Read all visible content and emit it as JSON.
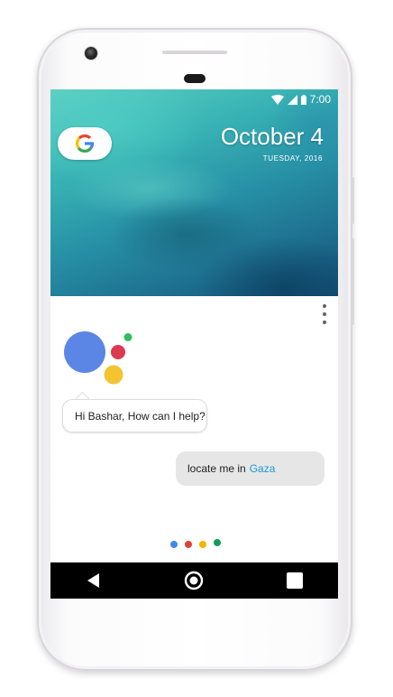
{
  "status_bar": {
    "time": "7:00"
  },
  "lockscreen": {
    "date": "October 4",
    "day": "TUESDAY, 2016",
    "search_widget_icon": "google-g-icon"
  },
  "assistant": {
    "menu_icon": "more-vert-icon",
    "greeting": "Hi Bashar, How can I help?",
    "user_query_prefix": "locate me in",
    "user_query_location": "Gaza",
    "listening_dot_colors": [
      "#4285f4",
      "#db4437",
      "#f4b400",
      "#0f9d58"
    ],
    "logo_colors": [
      "#5b86e5",
      "#db3a4f",
      "#f4c430",
      "#2fbf5a"
    ]
  },
  "nav_bar": {
    "back_icon": "back-triangle-icon",
    "home_icon": "home-circle-icon",
    "recents_icon": "recents-square-icon"
  }
}
